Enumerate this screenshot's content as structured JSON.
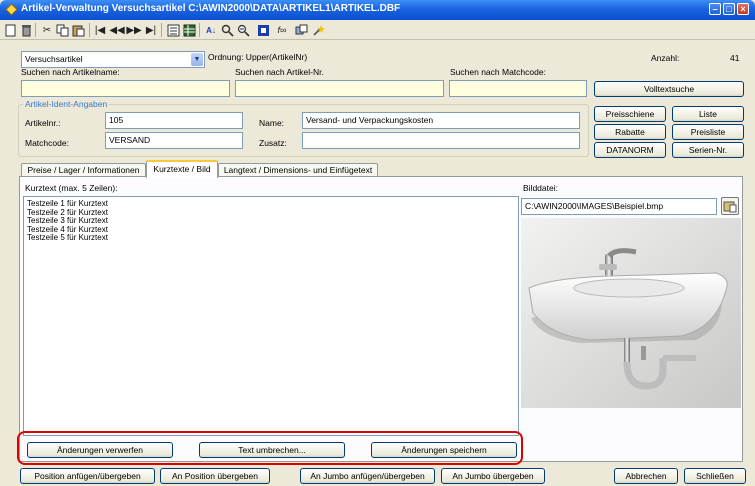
{
  "window": {
    "title": "Artikel-Verwaltung   Versuchsartikel   C:\\AWIN2000\\DATA\\ARTIKEL1\\ARTIKEL.DBF"
  },
  "header": {
    "record_select_value": "Versuchsartikel",
    "ordnung_label": "Ordnung: Upper(ArtikelNr)",
    "anzahl_label": "Anzahl:",
    "anzahl_value": "41"
  },
  "search": {
    "artikelname_label": "Suchen nach Artikelname:",
    "artikelnr_label": "Suchen nach Artikel-Nr.",
    "matchcode_label": "Suchen nach Matchcode:",
    "artikelname_value": "",
    "artikelnr_value": "",
    "matchcode_value": "",
    "volltext_button": "Volltextsuche"
  },
  "ident": {
    "group_title": "Artikel-Ident-Angaben",
    "artikelnr_label": "Artikelnr.:",
    "artikelnr_value": "105",
    "matchcode_label": "Matchcode:",
    "matchcode_value": "VERSAND",
    "name_label": "Name:",
    "name_value": "Versand- und Verpackungskosten",
    "zusatz_label": "Zusatz:",
    "zusatz_value": ""
  },
  "side_buttons": {
    "preisschiene": "Preisschiene",
    "liste": "Liste",
    "rabatte": "Rabatte",
    "preisliste": "Preisliste",
    "datanorm": "DATANORM",
    "seriennr": "Serien-Nr."
  },
  "tabs": [
    {
      "label": "Preise / Lager / Informationen"
    },
    {
      "label": "Kurztexte / Bild"
    },
    {
      "label": "Langtext / Dimensions- und Einfügetext"
    }
  ],
  "kurztext": {
    "label": "Kurztext (max. 5 Zeilen):",
    "lines": [
      "Testzeile 1 für Kurztext",
      "Testzeile 2 für Kurztext",
      "Testzeile 3 für Kurztext",
      "Testzeile 4 für Kurztext",
      "Testzeile 5 für Kurztext"
    ]
  },
  "bild": {
    "label": "Bilddatei:",
    "path": "C:\\AWIN2000\\IMAGES\\Beispiel.bmp"
  },
  "panel_buttons": {
    "verwerfen": "Änderungen verwerfen",
    "umbrechen": "Text umbrechen...",
    "speichern": "Änderungen speichern"
  },
  "footer_buttons": {
    "pos_anfuegen": "Position anfügen/übergeben",
    "pos_uebergeben": "An Position übergeben",
    "jumbo_anfuegen": "An Jumbo anfügen/übergeben",
    "jumbo_uebergeben": "An Jumbo übergeben",
    "abbrechen": "Abbrechen",
    "schliessen": "Schließen"
  },
  "colors": {
    "titlebar": "#1a63e0",
    "search_field_bg": "#ffffe0",
    "active_tab_accent": "#ffc83c",
    "highlight_box": "#e00000"
  },
  "icons": [
    "new-icon",
    "delete-icon",
    "cut-icon",
    "copy-icon",
    "paste-icon",
    "first-record-icon",
    "prev-record-icon",
    "next-record-icon",
    "last-record-icon",
    "form-icon",
    "table-icon",
    "sort-icon",
    "search-icon",
    "zoom-icon",
    "filter-icon",
    "formula-icon",
    "export-icon",
    "wizard-icon"
  ]
}
